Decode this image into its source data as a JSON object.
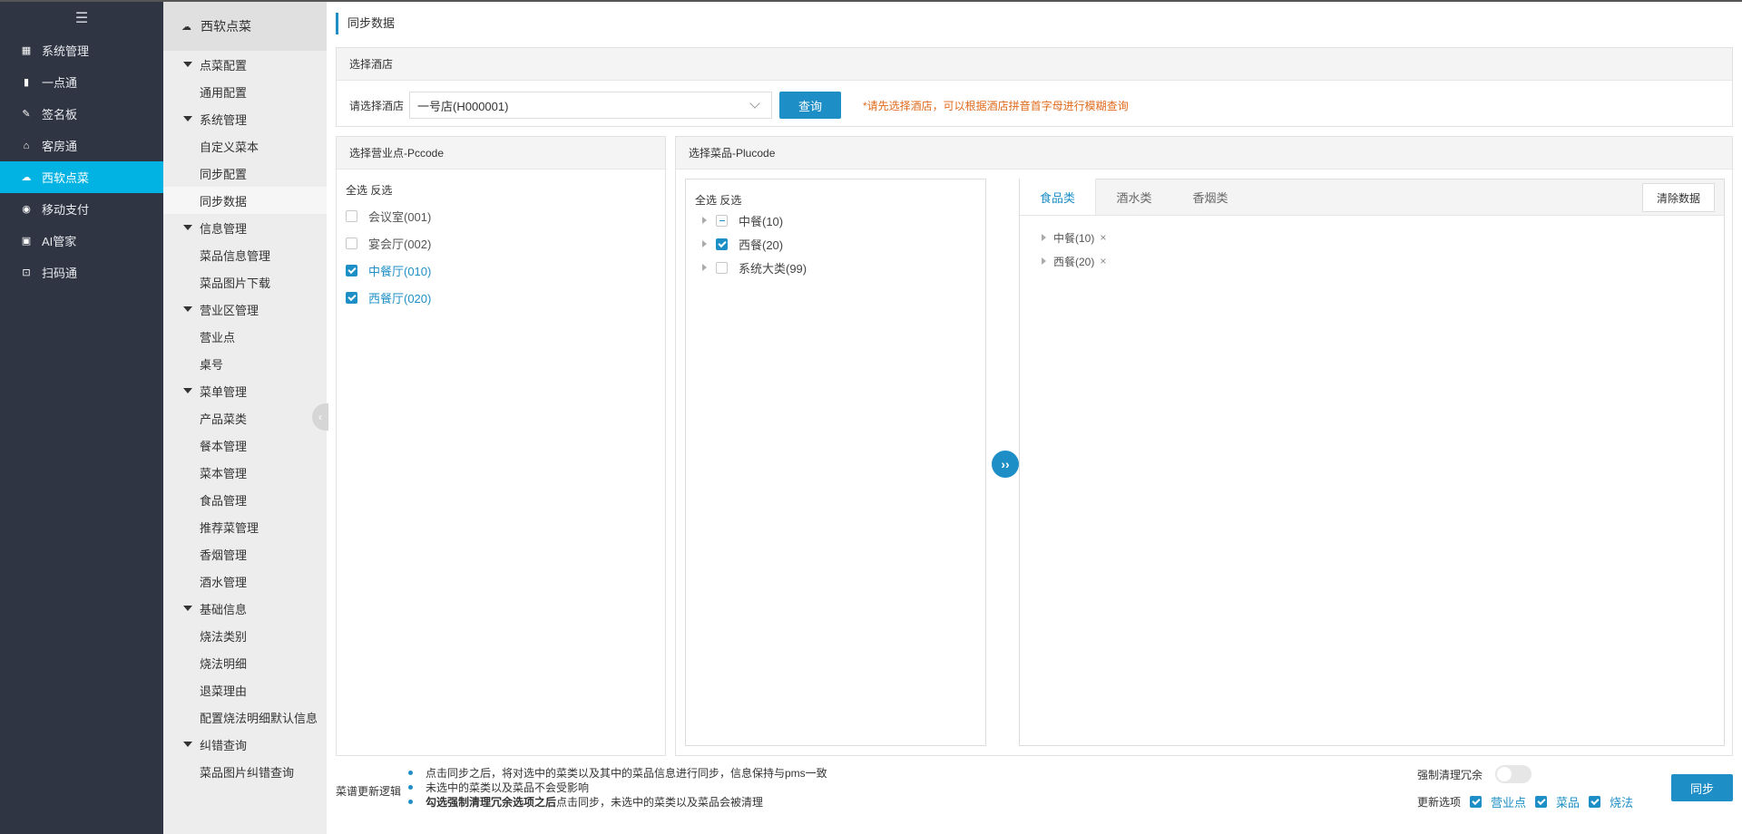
{
  "nav": {
    "menu_icon": "hamburger-icon",
    "items": [
      {
        "label": "系统管理",
        "icon": "grid-icon"
      },
      {
        "label": "一点通",
        "icon": "bar-chart-icon"
      },
      {
        "label": "签名板",
        "icon": "pen-icon"
      },
      {
        "label": "客房通",
        "icon": "home-icon"
      },
      {
        "label": "西软点菜",
        "icon": "cloud-icon",
        "active": true
      },
      {
        "label": "移动支付",
        "icon": "coin-icon"
      },
      {
        "label": "AI管家",
        "icon": "bag-icon"
      },
      {
        "label": "扫码通",
        "icon": "scan-icon"
      }
    ]
  },
  "submenu": {
    "title": "西软点菜",
    "groups": [
      {
        "label": "点菜配置",
        "items": [
          "通用配置"
        ]
      },
      {
        "label": "系统管理",
        "items": [
          "自定义菜本",
          "同步配置",
          "同步数据"
        ]
      },
      {
        "label": "信息管理",
        "items": [
          "菜品信息管理",
          "菜品图片下载"
        ]
      },
      {
        "label": "营业区管理",
        "items": [
          "营业点",
          "桌号"
        ]
      },
      {
        "label": "菜单管理",
        "items": [
          "产品菜类",
          "餐本管理",
          "菜本管理",
          "食品管理",
          "推荐菜管理",
          "香烟管理",
          "酒水管理"
        ]
      },
      {
        "label": "基础信息",
        "items": [
          "烧法类别",
          "烧法明细",
          "退菜理由",
          "配置烧法明细默认信息"
        ]
      },
      {
        "label": "纠错查询",
        "items": [
          "菜品图片纠错查询"
        ]
      }
    ],
    "active_item": "同步数据"
  },
  "page": {
    "title": "同步数据"
  },
  "hotel": {
    "panel_title": "选择酒店",
    "label": "请选择酒店",
    "selected": "一号店(H000001)",
    "query_btn": "查询",
    "hint": "*请先选择酒店，可以根据酒店拼音首字母进行模糊查询"
  },
  "pccode": {
    "panel_title": "选择营业点-Pccode",
    "ops": "全选 反选",
    "items": [
      {
        "label": "会议室(001)",
        "checked": false
      },
      {
        "label": "宴会厅(002)",
        "checked": false
      },
      {
        "label": "中餐厅(010)",
        "checked": true
      },
      {
        "label": "西餐厅(020)",
        "checked": true
      }
    ]
  },
  "plucode": {
    "panel_title": "选择菜品-Plucode",
    "ops": "全选 反选",
    "tree": [
      {
        "label": "中餐(10)",
        "state": "half"
      },
      {
        "label": "西餐(20)",
        "state": "checked"
      },
      {
        "label": "系统大类(99)",
        "state": "unchecked"
      }
    ],
    "tabs": [
      "食品类",
      "酒水类",
      "香烟类"
    ],
    "active_tab": "食品类",
    "clear_btn": "清除数据",
    "selected": [
      "中餐(10)",
      "西餐(20)"
    ],
    "remove_glyph": "×",
    "move_glyph": "››"
  },
  "footer": {
    "logic_label": "菜谱更新逻辑",
    "notes": [
      {
        "text": "点击同步之后，将对选中的菜类以及其中的菜品信息进行同步，信息保持与pms一致"
      },
      {
        "text": "未选中的菜类以及菜品不会受影响"
      },
      {
        "bold": "勾选强制清理冗余选项之后",
        "text": "点击同步，未选中的菜类以及菜品会被清理"
      }
    ],
    "force_label": "强制清理冗余",
    "force_on": false,
    "update_label": "更新选项",
    "update_opts": [
      {
        "label": "营业点",
        "checked": true
      },
      {
        "label": "菜品",
        "checked": true
      },
      {
        "label": "烧法",
        "checked": true
      }
    ],
    "sync_btn": "同步"
  }
}
